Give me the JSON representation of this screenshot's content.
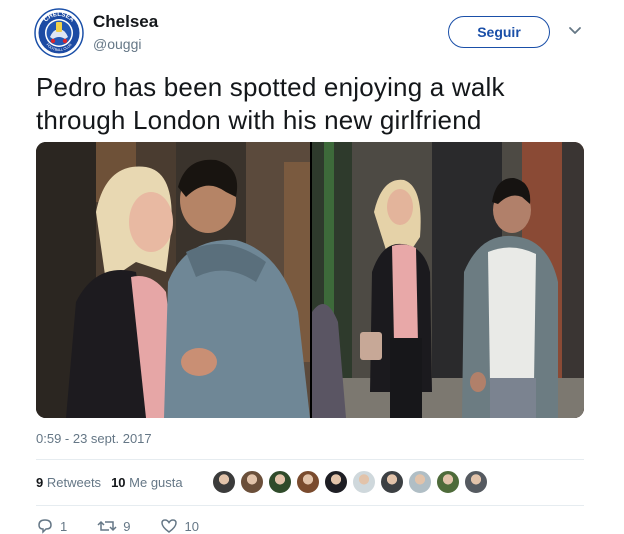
{
  "account": {
    "name": "Chelsea",
    "handle": "@ouggi",
    "avatar_icon": "chelsea-crest-icon",
    "crest_text": "CHELSEA",
    "crest_bottom_text": "FOOTBALL CLUB"
  },
  "follow_button": {
    "label": "Seguir"
  },
  "menu_icon": "chevron-down-icon",
  "tweet": {
    "text": "Pedro has been spotted enjoying a walk through London with his new girlfriend",
    "timestamp": "0:59 - 23 sept. 2017"
  },
  "stats": {
    "retweets_count": "9",
    "retweets_label": "Retweets",
    "likes_count": "10",
    "likes_label": "Me gusta"
  },
  "likers_count": 10,
  "actions": [
    {
      "name": "reply",
      "icon": "reply-icon",
      "count": "1"
    },
    {
      "name": "retweet",
      "icon": "retweet-icon",
      "count": "9"
    },
    {
      "name": "like",
      "icon": "heart-icon",
      "count": "10"
    }
  ],
  "colors": {
    "brand_blue": "#1a4fa8",
    "text": "#14171a",
    "muted": "#657786",
    "divider": "#e6ecf0"
  }
}
